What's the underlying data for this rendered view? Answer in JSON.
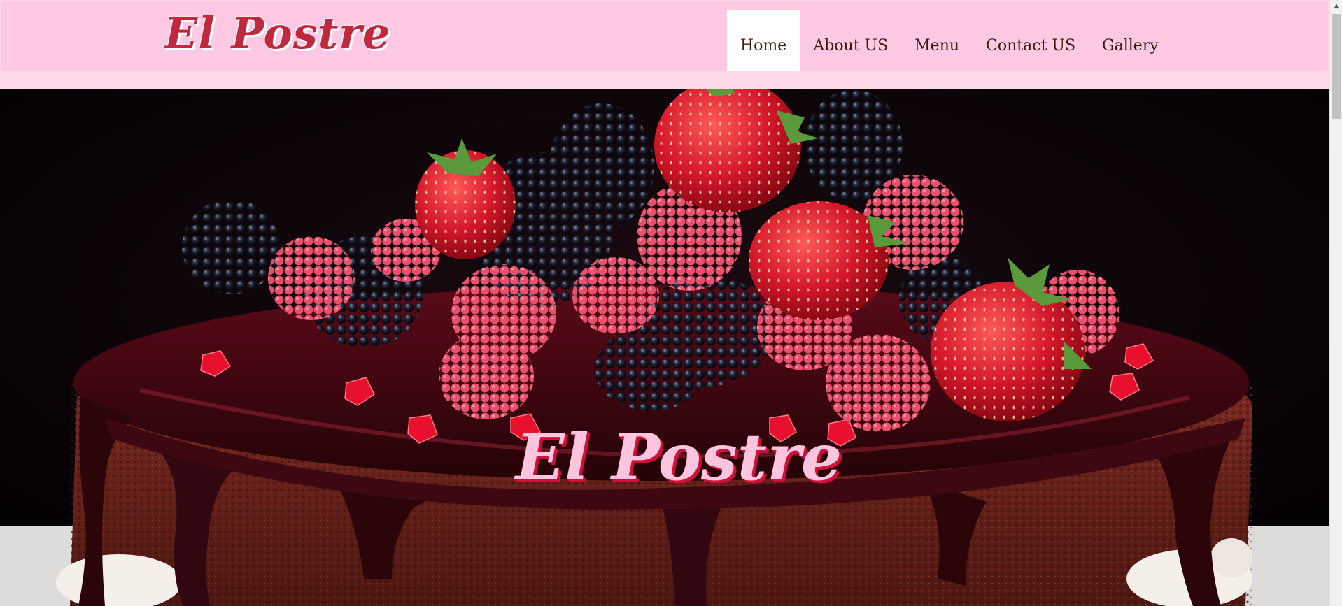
{
  "header": {
    "logo": "El Postre",
    "nav": [
      {
        "label": "Home",
        "active": true
      },
      {
        "label": "About US",
        "active": false
      },
      {
        "label": "Menu",
        "active": false
      },
      {
        "label": "Contact US",
        "active": false
      },
      {
        "label": "Gallery",
        "active": false
      }
    ]
  },
  "hero": {
    "title": "El Postre",
    "image": "chocolate-berry-cake-photo"
  },
  "colors": {
    "header_bg": "#ffc9e4",
    "logo": "#c0283e",
    "hero_title": "#ffc4de",
    "hero_title_shadow": "#d0103a"
  },
  "scrollbar": {
    "up_icon": "scroll-up-arrow-icon"
  }
}
